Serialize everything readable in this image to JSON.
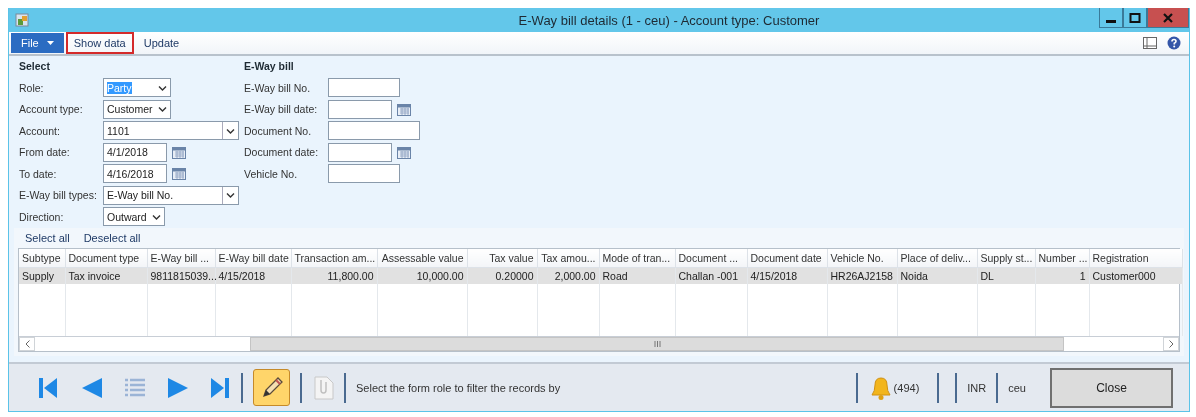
{
  "window": {
    "title": "E-Way bill details (1 - ceu) - Account type: Customer"
  },
  "toolbar": {
    "menu": "File",
    "actions": [
      {
        "label": "Show data",
        "highlighted": true
      },
      {
        "label": "Update",
        "highlighted": false
      }
    ]
  },
  "select": {
    "title": "Select",
    "fields": [
      {
        "label": "Role:",
        "kind": "dropdown",
        "value": "Party",
        "text_selected": true
      },
      {
        "label": "Account type:",
        "kind": "dropdown",
        "value": "Customer",
        "text_selected": false
      },
      {
        "label": "Account:",
        "kind": "lookup",
        "value": "1101",
        "text_selected": false
      },
      {
        "label": "From date:",
        "kind": "date",
        "value": "4/1/2018",
        "text_selected": false
      },
      {
        "label": "To date:",
        "kind": "date",
        "value": "4/16/2018",
        "text_selected": false
      },
      {
        "label": "E-Way bill types:",
        "kind": "lookup",
        "value": "E-Way bill No.",
        "text_selected": false
      },
      {
        "label": "Direction:",
        "kind": "dropdown",
        "value": "Outward",
        "text_selected": false
      }
    ]
  },
  "eway_bill": {
    "title": "E-Way bill",
    "fields": [
      {
        "label": "E-Way bill No.",
        "kind": "text"
      },
      {
        "label": "E-Way bill date:",
        "kind": "date"
      },
      {
        "label": "Document No.",
        "kind": "text"
      },
      {
        "label": "Document date:",
        "kind": "date"
      },
      {
        "label": "Vehicle No.",
        "kind": "text"
      }
    ]
  },
  "grid": {
    "actions": [
      "Select all",
      "Deselect all"
    ],
    "columns": [
      "Subtype",
      "Document type",
      "E-Way bill ...",
      "E-Way bill date",
      "Transaction am...",
      "Assessable value",
      "Tax value",
      "Tax amou...",
      "Mode of tran...",
      "Document ...",
      "Document date",
      "Vehicle No.",
      "Place of deliv...",
      "Supply st...",
      "Number ...",
      "Registration"
    ],
    "rows": [
      {
        "selected": true,
        "cells": [
          "Supply",
          "Tax invoice",
          "9811815039...",
          "4/15/2018",
          "11,800.00",
          "10,000.00",
          "0.20000",
          "2,000.00",
          "Road",
          "Challan -001",
          "4/15/2018",
          "HR26AJ2158",
          "Noida",
          "DL",
          "1",
          "Customer000"
        ]
      }
    ]
  },
  "footer": {
    "edit_mode": true,
    "status_text": "Select the form role to filter the records by",
    "notifications": "(494)",
    "currency": "INR",
    "company": "ceu",
    "close_button": "Close"
  }
}
